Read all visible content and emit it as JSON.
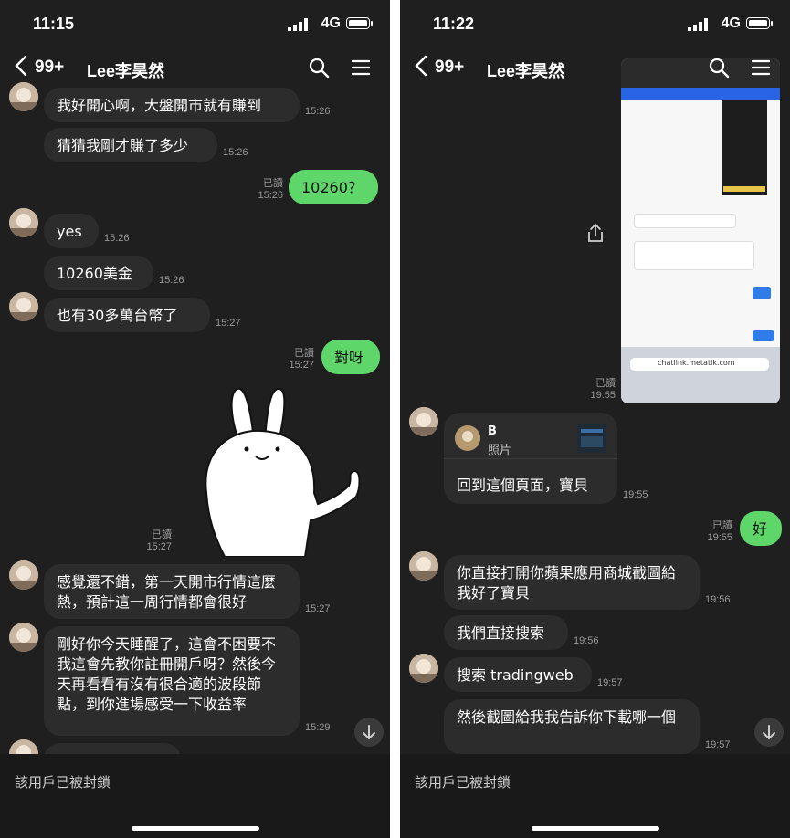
{
  "left": {
    "status": {
      "time": "11:15",
      "network": "4G"
    },
    "nav": {
      "badge": "99+",
      "title": "Lee李昊然"
    },
    "messages": [
      {
        "text": "我好開心啊，大盤開市就有賺到",
        "time": "15:26"
      },
      {
        "text": "猜猜我剛才賺了多少",
        "time": "15:26"
      },
      {
        "text": "10260？",
        "read": "已讀",
        "time": "15:26"
      },
      {
        "text": "yes",
        "time": "15:26"
      },
      {
        "text": "10260美金",
        "time": "15:26"
      },
      {
        "text": "也有30多萬台幣了",
        "time": "15:27"
      },
      {
        "text": "對呀",
        "read": "已讀",
        "time": "15:27"
      },
      {
        "sticker": "rabbit-thumbs-up",
        "read": "已讀",
        "time": "15:27"
      },
      {
        "text": "感覺還不錯，第一天開市行情這麼熱，預計這一周行情都會很好",
        "time": "15:27"
      },
      {
        "text": "剛好你今天睡醒了，這會不困要不我這會先教你註冊開戶呀？然後今天再看看有沒有很合適的波段節點，到你進場感受一下收益率",
        "time": "15:29"
      }
    ],
    "footer": "該用戶已被封鎖"
  },
  "right": {
    "status": {
      "time": "11:22",
      "network": "4G"
    },
    "nav": {
      "badge": "99+",
      "title": "Lee李昊然"
    },
    "image_message": {
      "read": "已讀",
      "time": "19:55",
      "url_text": "chatlink.metatik.com"
    },
    "link_card": {
      "name": "B",
      "type": "照片",
      "text": "回到這個頁面，寶貝",
      "time": "19:55"
    },
    "messages": [
      {
        "text": "好",
        "read": "已讀",
        "time": "19:55"
      },
      {
        "text": "你直接打開你蘋果應用商城截圖給我好了寶貝",
        "time": "19:56"
      },
      {
        "text": "我們直接搜索",
        "time": "19:56"
      },
      {
        "text": "搜索 tradingweb",
        "time": "19:57"
      },
      {
        "text": "然後截圖給我我告訴你下載哪一個",
        "time": "19:57"
      }
    ],
    "footer": "該用戶已被封鎖"
  },
  "colors": {
    "background": "#1f1f1f",
    "bubble": "#2c2c2c",
    "green": "#5fd66a",
    "muted": "#9a9a9a"
  }
}
